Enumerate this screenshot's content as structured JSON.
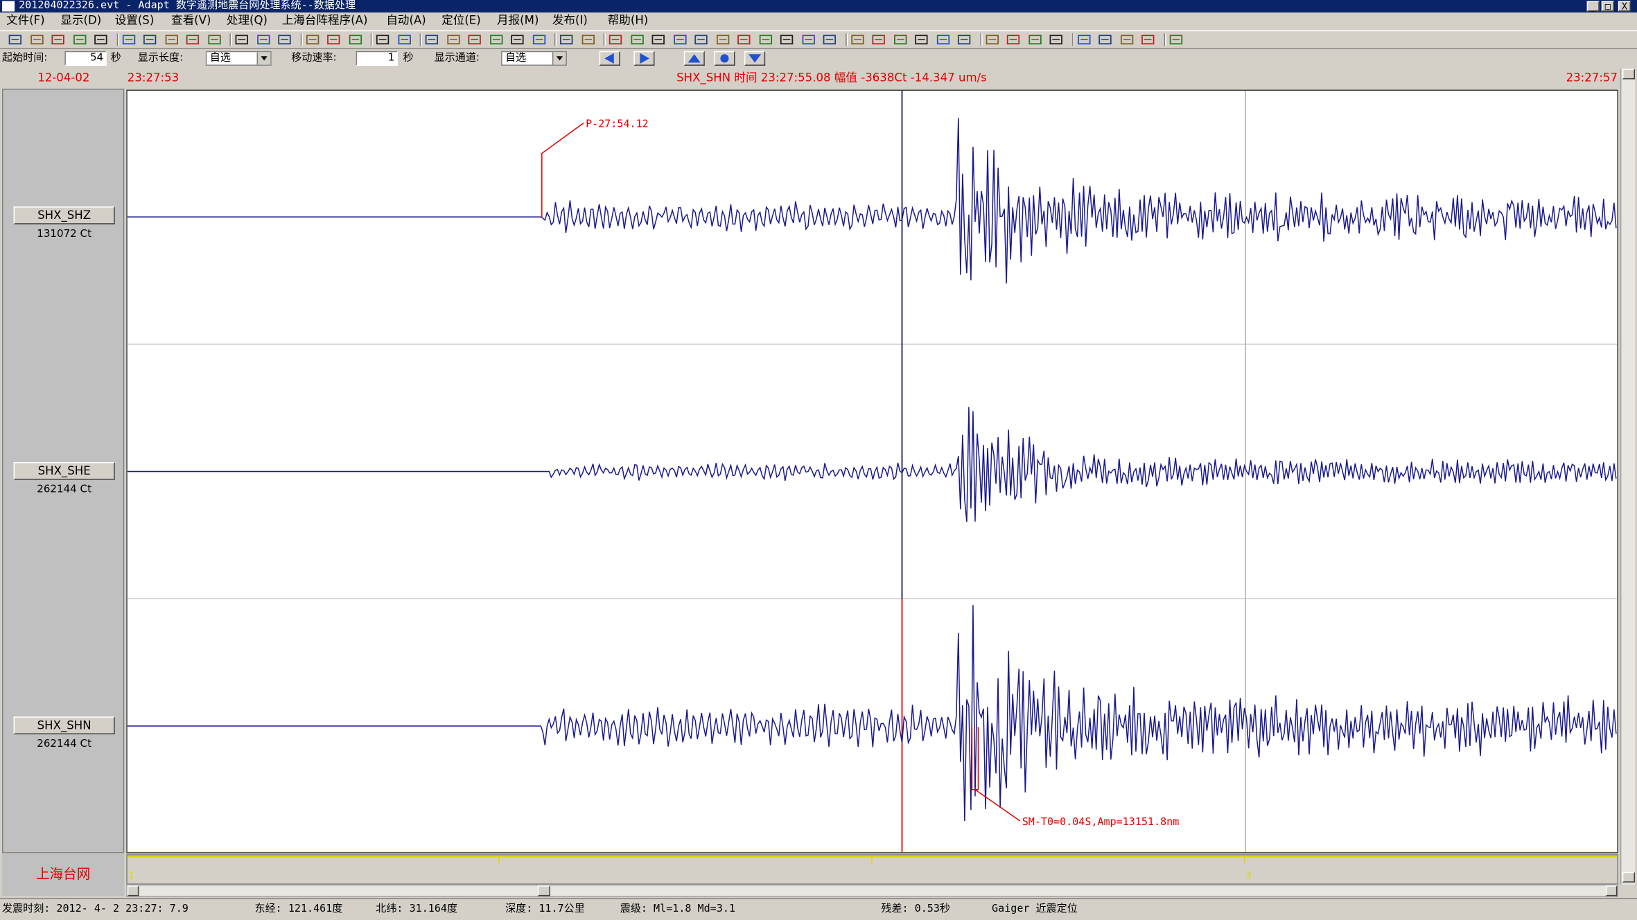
{
  "window": {
    "title": "201204022326.evt - Adapt 数字遥测地震台网处理系统--数据处理",
    "buttons": [
      "_",
      "□",
      "X"
    ]
  },
  "menu": [
    "文件(F)",
    "显示(D)",
    "设置(S)",
    "查看(V)",
    "处理(Q)",
    "上海台阵程序(A)",
    "自动(A)",
    "定位(E)",
    "月报(M)",
    "发布(I)",
    "帮助(H)"
  ],
  "toolbar": {
    "icons": [
      "open-icon",
      "open2-icon",
      "open3-icon",
      "open4-icon",
      "open5-icon",
      "save-icon",
      "save2-icon",
      "save3-icon",
      "save4-icon",
      "save5-icon",
      "print-icon",
      "preview-icon",
      "copy-icon",
      "columns-icon",
      "list-icon",
      "sort-icon",
      "filter-f-icon",
      "filter-f2-icon",
      "rotate-icon",
      "pick-icon",
      "pick2-icon",
      "pick3-icon",
      "pick4-icon",
      "eraser-icon",
      "binoculars-icon",
      "zoom-icon",
      "mark-icon",
      "mark2-icon",
      "locate-icon",
      "spectrum-icon",
      "spectrum2-icon",
      "circle-icon",
      "map-icon",
      "wave-icon",
      "star-icon",
      "bird-icon",
      "globe-icon",
      "grid-icon",
      "grid2-icon",
      "grid3-icon",
      "grid4-icon",
      "grid5-icon",
      "table-icon",
      "calc-icon",
      "sound-icon",
      "edit-icon",
      "report-icon",
      "left-arrow-icon",
      "right-arrow-icon",
      "up-arrow-icon",
      "down-arrow-icon",
      "help-icon"
    ]
  },
  "controls": {
    "start_time_label": "起始时间:",
    "start_time_value": "54",
    "start_time_unit": "秒",
    "display_length_label": "显示长度:",
    "display_length_value": "自选",
    "move_speed_label": "移动速率:",
    "move_speed_value": "1",
    "move_speed_unit": "秒",
    "display_channel_label": "显示通道:",
    "display_channel_value": "自选"
  },
  "info": {
    "date": "12-04-02",
    "start_time": "23:27:53",
    "cursor": "SHX_SHN  时间 23:27:55.08  幅值    -3638Ct    -14.347 um/s",
    "end_time": "23:27:57"
  },
  "channels": [
    {
      "name": "SHX_SHZ",
      "gain": "131072 Ct"
    },
    {
      "name": "SHX_SHE",
      "gain": "262144 Ct"
    },
    {
      "name": "SHX_SHN",
      "gain": "262144 Ct"
    }
  ],
  "annotations": {
    "p_pick": "P-27:54.12",
    "sm_pick": "SM-T0=0.04S,Amp=13151.8nm"
  },
  "overview": {
    "ticks": [
      "1",
      "3"
    ]
  },
  "network_label": "上海台网",
  "status": {
    "origin_time": "发震时刻:  2012- 4- 2  23:27: 7.9",
    "longitude": "东经: 121.461度",
    "latitude": "北纬: 31.164度",
    "depth": "深度:  11.7公里",
    "magnitude": "震级:  Ml=1.8 Md=3.1",
    "residual": "残差: 0.53秒",
    "method": "Gaiger 近震定位"
  },
  "colors": {
    "trace": "#1a1a8c",
    "pick": "#e00000",
    "cursor_line": "#1a1a5c",
    "titlebar": "#0a246a"
  }
}
